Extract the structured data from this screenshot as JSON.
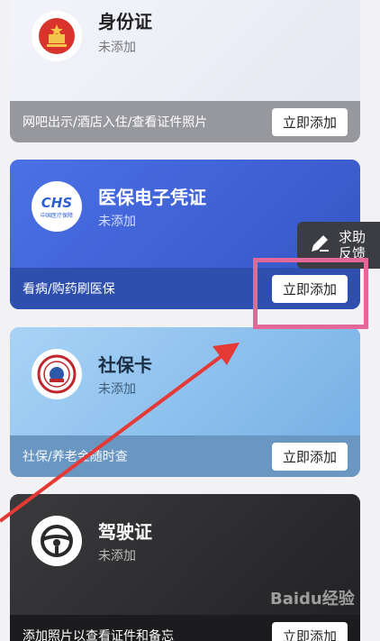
{
  "cards": [
    {
      "title": "身份证",
      "status": "未添加",
      "desc": "网吧出示/酒店入住/查看证件照片",
      "button": "立即添加",
      "icon": "national-emblem-icon"
    },
    {
      "title": "医保电子凭证",
      "status": "未添加",
      "desc": "看病/购药刷医保",
      "button": "立即添加",
      "icon": "chs-logo-icon",
      "icon_text": "CHS",
      "icon_subtext": "中国医疗保障"
    },
    {
      "title": "社保卡",
      "status": "未添加",
      "desc": "社保/养老金随时查",
      "button": "立即添加",
      "icon": "social-security-badge-icon"
    },
    {
      "title": "驾驶证",
      "status": "未添加",
      "desc": "添加照片以查看证件和备忘",
      "button": "立即添加",
      "icon": "steering-wheel-icon"
    }
  ],
  "feedback": {
    "label_line1": "求助",
    "label_line2": "反馈",
    "icon": "pencil-icon"
  },
  "annotation": {
    "highlight_color": "#e4679a",
    "arrow_color": "#e53935"
  },
  "watermark": "Baidu经验"
}
